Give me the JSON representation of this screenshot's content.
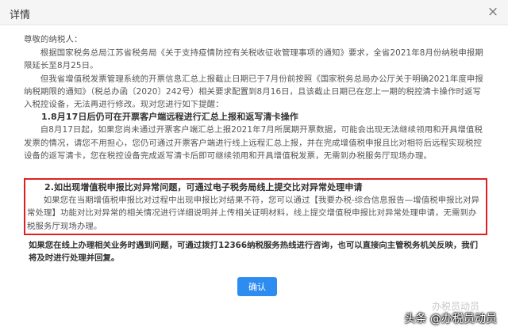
{
  "dialog": {
    "title": "详情",
    "close_symbol": "×"
  },
  "content": {
    "greeting": "尊敬的纳税人：",
    "para1": "根据国家税务总局江苏省税务局《关于支持疫情防控有关税收征收管理事项的通知》要求，全省2021年8月份纳税申报期限延长至8月25日。",
    "para2": "但我省增值税发票管理系统的开票信息汇总上报截止日期已于7月份前按照《国家税务总局办公厅关于明确2021年度申报纳税期限的通知》（税总办函〔2020〕242号）相关要求配置到8月16日，且该截止日期已在您上一期的税控清卡操作时返写入税控设备，无法再进行修改。现对您进行如下提醒：",
    "section1_title": "1.8月17日后仍可在开票客户端远程进行汇总上报和返写清卡操作",
    "section1_body": "自8月17日起，如果您尚未通过开票客户端汇总上报2021年7月所属期开票数据，可能会出现无法继续领用和开具增值税发票的情况，请您不用担心，您仍可通过开票客户端进行线上远程汇总上报，并在完成增值税申报且比对相符后远程实现税控设备的返写清卡，您在税控设备完成返写清卡后即可继续领用和开具增值税发票，无需到办税服务厅现场办理。",
    "section2_title": "2.如出现增值税申报比对异常问题，可通过电子税务局线上提交比对异常处理申请",
    "section2_body": "如果您在当期增值税申报比对过程中出现申报比对结果不符，您可以通过【我要办税-综合信息报告—增值税申报比对异常处理】功能对比对异常的相关情况进行详细说明并上传相关证明材料，线上提交增值税申报比对异常处理申请，无需到办税服务厅现场办理。",
    "footer_note": "如果您在线上办理相关业务时遇到问题，可通过拨打12366纳税服务热线进行咨询，也可以直接向主管税务机关反映，我们将及时进行处理并回复。"
  },
  "buttons": {
    "confirm_label": "确认"
  },
  "watermarks": {
    "top": "办税员动员",
    "bottom": "头条 @办税员动员"
  },
  "colors": {
    "highlight_border": "#e02020",
    "confirm_button": "#2d8cf0"
  }
}
